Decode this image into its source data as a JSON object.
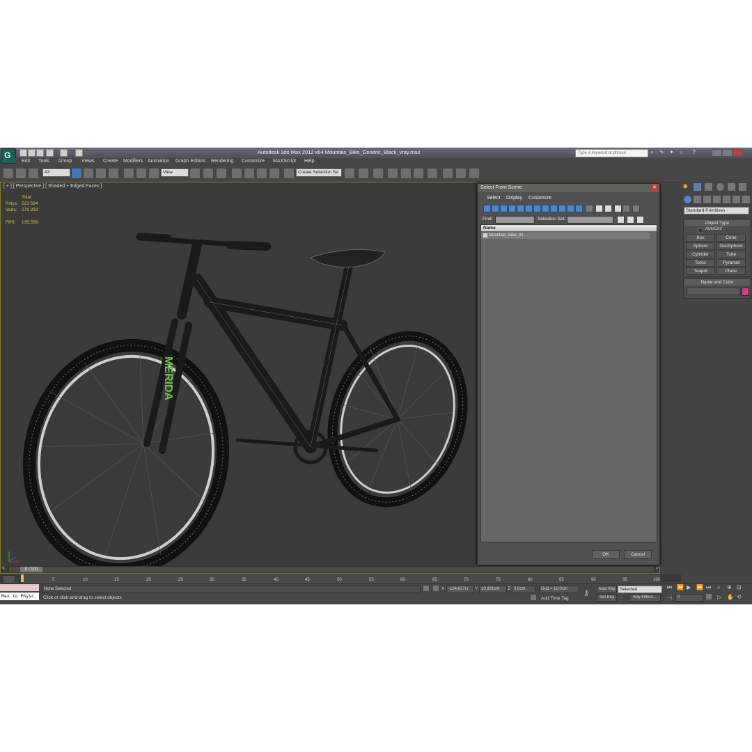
{
  "app": {
    "title": "Autodesk 3ds Max 2012 x64     Mountain_Bike_Generic_Black_vray.max",
    "search_placeholder": "Type a keyword or phrase",
    "accent": "#1d5f5a"
  },
  "menubar": {
    "items": [
      "Edit",
      "Tools",
      "Group",
      "Views",
      "Create",
      "Modifiers",
      "Animation",
      "Graph Editors",
      "Rendering",
      "Customize",
      "MAXScript",
      "Help"
    ]
  },
  "toolbar": {
    "selection_filter": "All",
    "reference_coord": "View",
    "named_selection": "Create Selection Se"
  },
  "viewport": {
    "label": "[ + ] [ Perspective ] [ Shaded + Edged Faces ]",
    "stats": {
      "total_label": "Total",
      "polys_label": "Polys:",
      "polys_value": "523 594",
      "verts_label": "Verts:",
      "verts_value": "279 293",
      "fps_label": "FPS:",
      "fps_value": "135,558"
    },
    "model_text": "MERIDA",
    "background": "#3b3b3b"
  },
  "dialog": {
    "title": "Select From Scene",
    "menus": [
      "Select",
      "Display",
      "Customize"
    ],
    "find_label": "Find:",
    "selection_set_label": "Selection Set:",
    "column_header": "Name",
    "rows": [
      "Mountain_Bike_01"
    ],
    "ok_label": "OK",
    "cancel_label": "Cancel"
  },
  "command_panel": {
    "dropdown": "Standard Primitives",
    "object_type_title": "Object Type",
    "autogrid_label": "AutoGrid",
    "buttons": [
      "Box",
      "Cone",
      "Sphere",
      "GeoSphere",
      "Cylinder",
      "Tube",
      "Torus",
      "Pyramid",
      "Teapot",
      "Plane"
    ],
    "name_color_title": "Name and Color",
    "object_color": "#d63c8c"
  },
  "timeline": {
    "slider_label": "0 / 100",
    "ticks": [
      "5",
      "10",
      "15",
      "20",
      "25",
      "30",
      "35",
      "40",
      "45",
      "50",
      "55",
      "60",
      "65",
      "70",
      "75",
      "80",
      "85",
      "90",
      "95",
      "100"
    ]
  },
  "status": {
    "maxscript_listener": "Max to Physc.",
    "selection_status": "None Selected",
    "prompt": "Click or click-and-drag to select objects",
    "x_label": "X:",
    "x_value": "-104,617cr",
    "y_label": "Y:",
    "y_value": "10,921cm",
    "z_label": "Z:",
    "z_value": "0,0cm",
    "grid": "Grid = 10,0cm",
    "auto_key": "Auto Key",
    "set_key": "Set Key",
    "key_mode": "Selected",
    "key_filters": "Key Filters...",
    "add_time_tag": "Add Time Tag",
    "frame_value": "0"
  }
}
